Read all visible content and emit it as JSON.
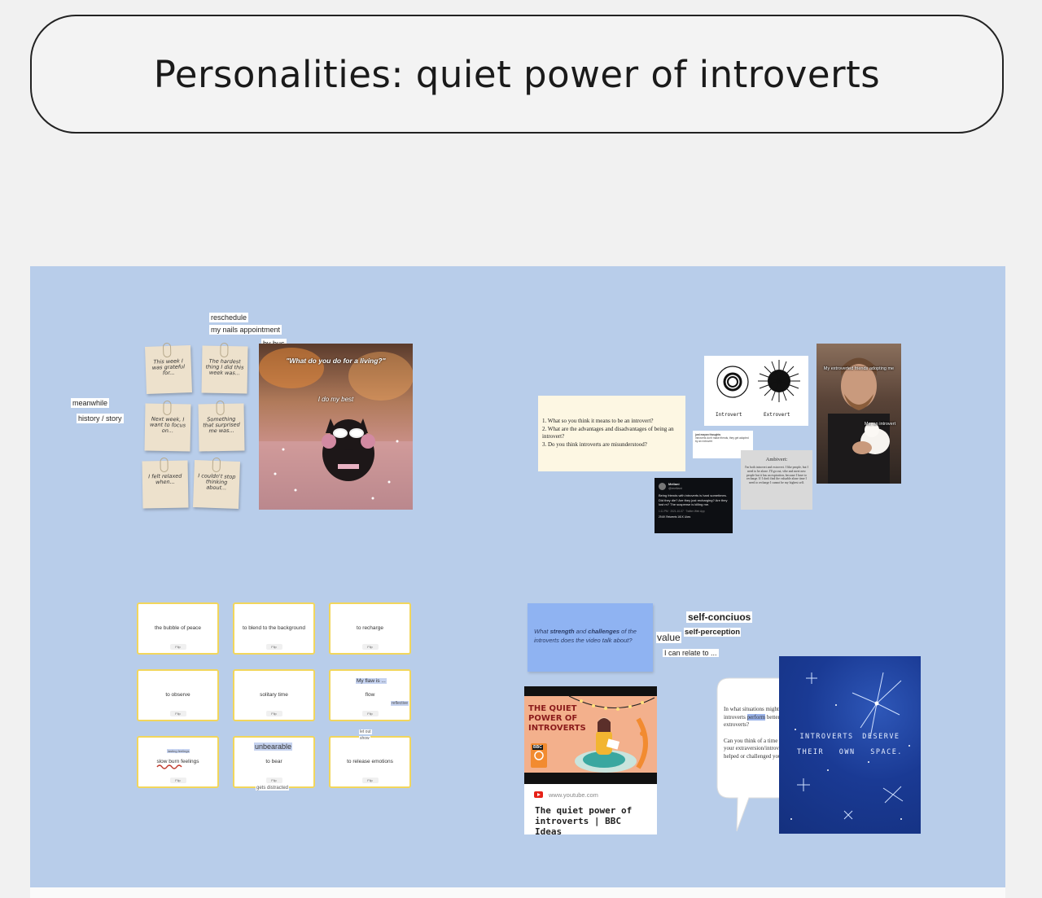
{
  "title": "Personalities: quiet power of introverts",
  "board": {
    "background": "#b8cdea"
  },
  "left_top": {
    "tags": {
      "reschedule": "reschedule",
      "nails": "my nails appointment",
      "bus": "by bus",
      "meanwhile": "meanwhile",
      "history": "history / story"
    },
    "notes": [
      "This week I was grateful for...",
      "The hardest thing I did this week was...",
      "Next week, I want to focus on...",
      "Something that surprised me was...",
      "I felt relaxed when...",
      "I couldn't stop thinking about..."
    ],
    "meme": {
      "caption_top": "\"What do you do for a living?\"",
      "caption_mid": "I do my best"
    }
  },
  "right_top": {
    "questions": [
      "1. What so you think it means to be an introvert?",
      "2. What are the advantages and disadvantages of being an introvert?",
      "3. Do you think introverts are misunderstood?"
    ],
    "diagram": {
      "left_label": "Introvert",
      "right_label": "Extrovert"
    },
    "ambivert": {
      "title": "Ambivert:",
      "body": "I'm both introvert and extrovert. I like people, but I need to be alone. I'll go out, vibe and meet new people but it has an expiration, because I have to recharge. If I don't find the valuable alone time I need to recharge I cannot be my highest self."
    },
    "tweet_small": {
      "name": "just mayan thoughts",
      "text": "Introverts don't make friends, they get adopted by an extrovert"
    },
    "tweet_dark": {
      "name": "Mellani",
      "handle": "@mellani",
      "text": "Being friends with introverts is hard sometimes. Did they die? Are they just recharging? Are they lost rn? The suspense is killing me.",
      "time": "1:11 PM · 2021-10-07 · Twitter Web App",
      "stats": "29.6K Retweets  161K Likes"
    },
    "photo": {
      "caption_top": "My extroverted friends adopting me",
      "caption_bottom": "Me, an introvert"
    }
  },
  "left_bottom": {
    "cards": [
      "the bubble of peace",
      "to blend to the background",
      "to recharge",
      "to observe",
      "solitary time",
      "flow",
      "slow burn feelings",
      "to bear",
      "to release emotions"
    ],
    "flip_label": "Flip",
    "annotations": {
      "flaw": "My flaw is ...",
      "reflective": "reflective",
      "letout": "let out",
      "show": "show",
      "unbearable": "unbearable",
      "distracted": "gets distracted",
      "lasting": "lasting feelings"
    }
  },
  "right_bottom": {
    "question_card": {
      "prefix": "What ",
      "strong1": "strength",
      "mid": " and ",
      "strong2": "challenges",
      "suffix": " of the introverts does the video talk about?"
    },
    "tags": {
      "selfconscious": "self-conciuos",
      "selfperception": "self-perception",
      "value": "value",
      "relate": "I can relate to ..."
    },
    "video": {
      "thumb_title": "THE QUIET POWER OF INTROVERTS",
      "brand": "BBC",
      "url": "www.youtube.com",
      "title": "The quiet power of introverts | BBC Ideas"
    },
    "bubble": {
      "q1_a": "In what situations might introverts ",
      "q1_highlight": "perform",
      "q1_b": " better than extroverts?",
      "q2": "Can you think of a time when your extraversion/introversion helped or challenged you?"
    },
    "poster": {
      "line1": "INTROVERTS DESERVE",
      "line2": "THEIR OWN SPACE."
    }
  }
}
